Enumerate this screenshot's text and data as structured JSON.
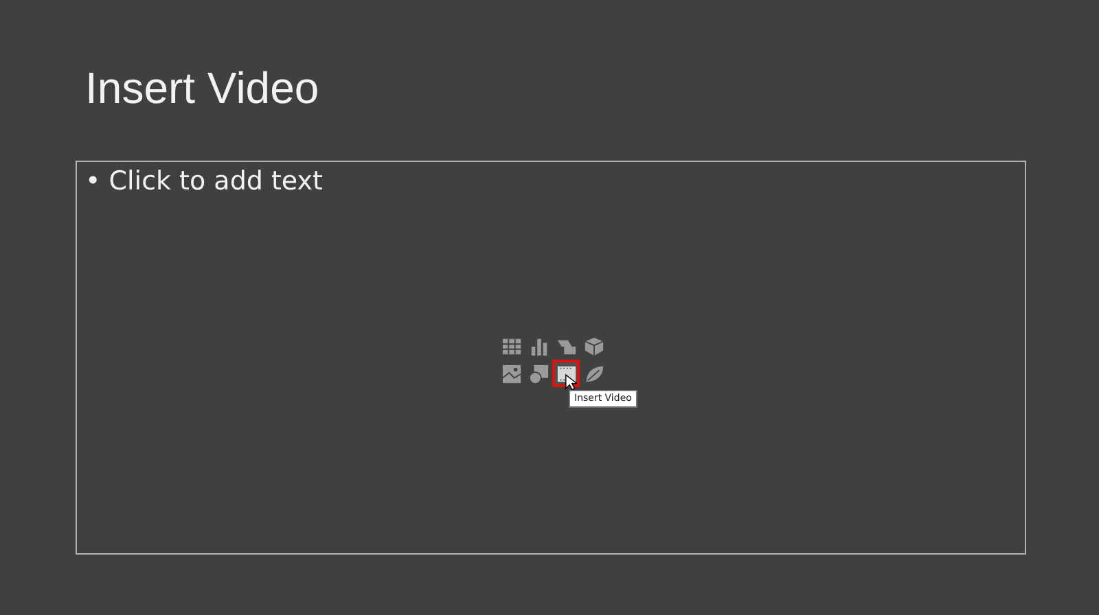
{
  "slide": {
    "title": "Insert Video",
    "placeholder": "• Click to add text",
    "content_icons": [
      {
        "kind": "table",
        "selected": false
      },
      {
        "kind": "chart",
        "selected": false
      },
      {
        "kind": "smartart",
        "selected": false
      },
      {
        "kind": "model",
        "selected": false
      },
      {
        "kind": "picture",
        "selected": false
      },
      {
        "kind": "online-picture",
        "selected": false
      },
      {
        "kind": "video",
        "selected": true
      },
      {
        "kind": "icons",
        "selected": false
      }
    ],
    "tooltip": "Insert Video"
  }
}
